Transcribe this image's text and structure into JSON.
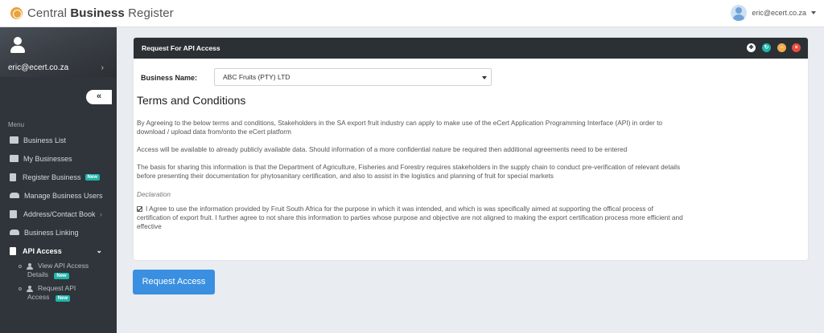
{
  "app": {
    "name_light": "Central ",
    "name_bold": "Business",
    "name_suffix": " Register"
  },
  "header": {
    "user_email": "eric@ecert.co.za"
  },
  "sidebar": {
    "profile_email": "eric@ecert.co.za",
    "menu_label": "Menu",
    "items": [
      {
        "label": "Business List"
      },
      {
        "label": "My Businesses"
      },
      {
        "label": "Register Business",
        "badge": "New"
      },
      {
        "label": "Manage Business Users"
      },
      {
        "label": "Address/Contact Book"
      },
      {
        "label": "Business Linking"
      },
      {
        "label": "API Access"
      }
    ],
    "subitems": [
      {
        "line1": "View API Access",
        "line2": "Details",
        "badge": "New"
      },
      {
        "line1": "Request API",
        "line2": "Access",
        "badge": "New"
      }
    ]
  },
  "panel": {
    "title": "Request For API Access",
    "business_name_label": "Business Name:",
    "business_name_value": "ABC Fruits (PTY) LTD",
    "terms_title": "Terms and Conditions",
    "paragraphs": [
      "By Agreeing to the below terms and conditions, Stakeholders in the SA export fruit industry can apply to make use of the eCert Application Programming Interface (API) in order to download / upload data from/onto the eCert platform",
      "Access will be available to already publicly available data. Should information of a more confidential nature be required then additional agreements need to be entered",
      "The basis for sharing this information is that the Department of Agriculture, Fisheries and Forestry requires stakeholders in the supply chain to conduct pre-verification of relevant details before presenting their documentation for phytosanitary certification, and also to assist in the logistics and planning of fruit for special markets"
    ],
    "declaration_label": "Declaration",
    "agreement_text": "I Agree to use the information provided by Fruit South Africa for the purpose in which it was intended, and which is was specifically aimed at supporting the offical process of certification of export fruit. I further agree to not share this information to parties whose purpose and objective are not aligned to making the export certification process more efficient and effective",
    "agreement_checked": true
  },
  "actions": {
    "request_button": "Request Access"
  },
  "colors": {
    "accent": "#3a8fe0",
    "sidebar": "#2f353a",
    "badge": "#1fb5ad"
  }
}
